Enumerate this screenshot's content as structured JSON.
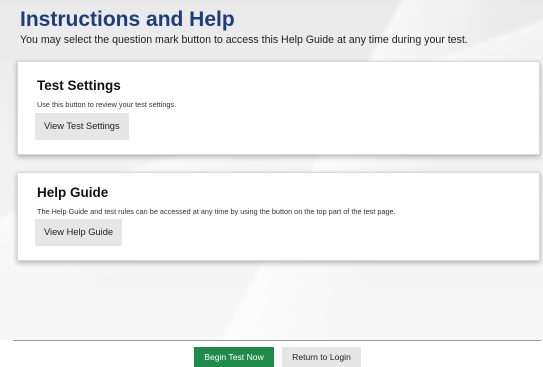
{
  "header": {
    "title": "Instructions and Help",
    "subtitle": "You may select the question mark button to access this Help Guide at any time during your test."
  },
  "cards": [
    {
      "title": "Test Settings",
      "description": "Use this button to review your test settings.",
      "button_label": "View Test Settings"
    },
    {
      "title": "Help Guide",
      "description": "The Help Guide and test rules can be accessed at any time by using the button on the top part of the test page.",
      "button_label": "View Help Guide"
    }
  ],
  "footer": {
    "begin_label": "Begin Test Now",
    "return_label": "Return to Login"
  },
  "colors": {
    "title": "#1f3c7a",
    "begin_button": "#1f8a4a",
    "secondary_button": "#e6e6e6"
  }
}
